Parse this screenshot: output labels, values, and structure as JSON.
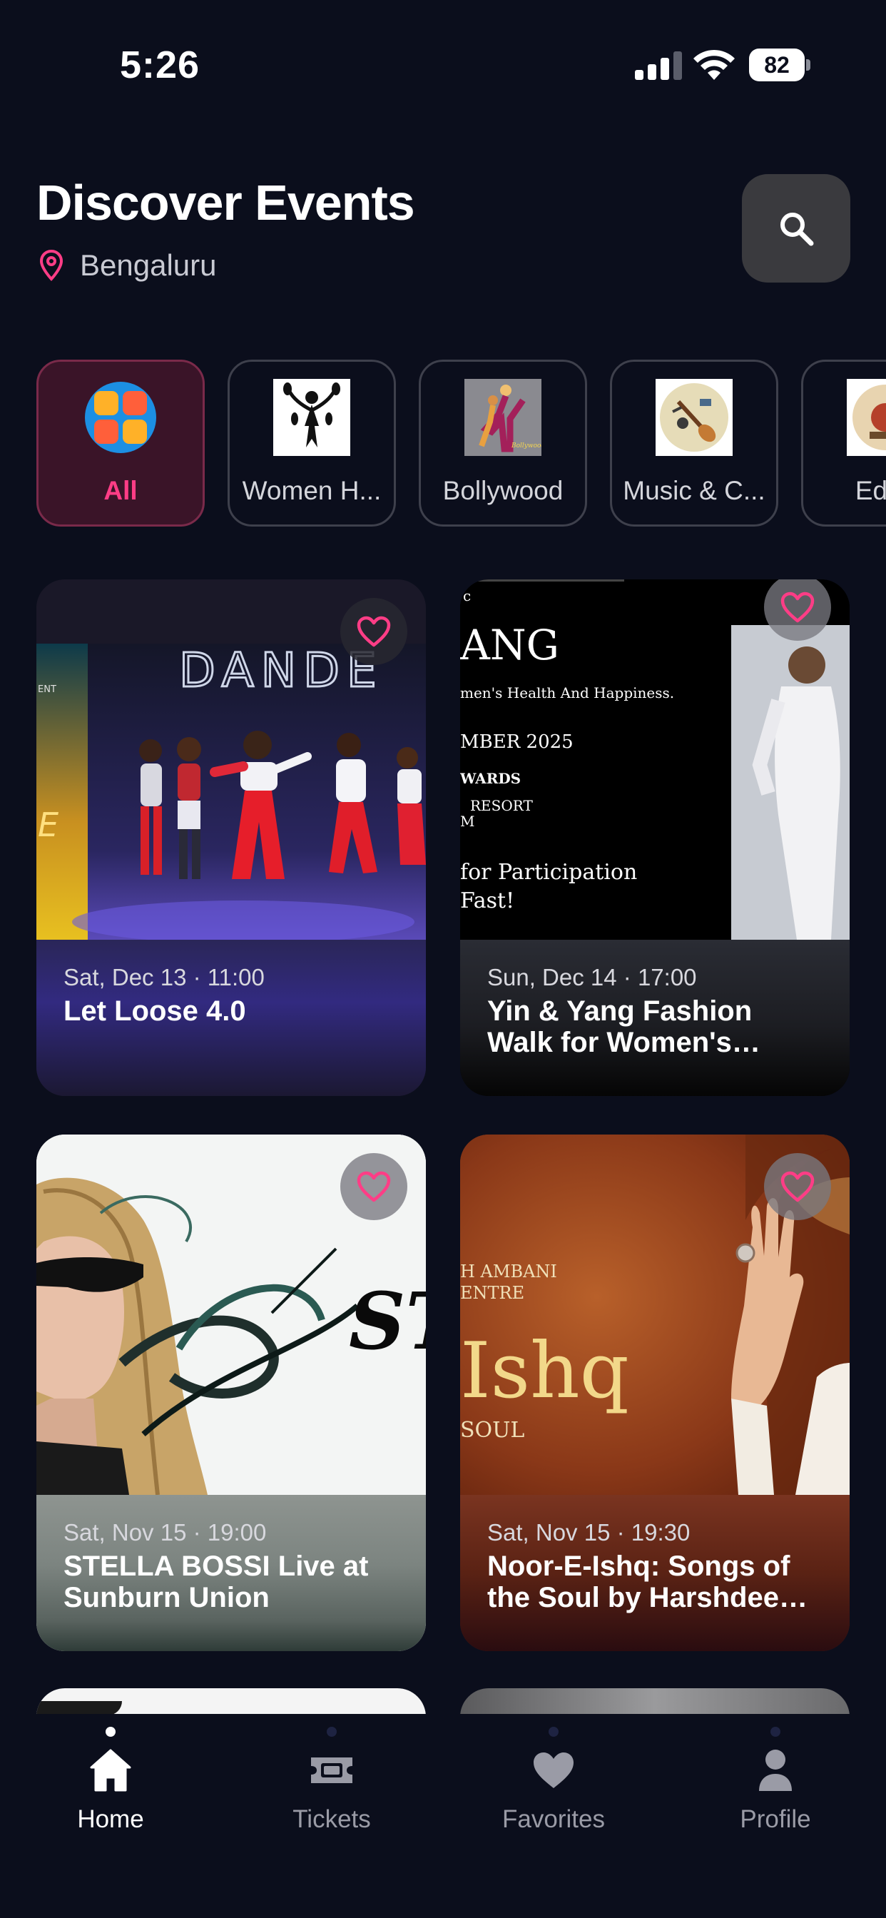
{
  "status_bar": {
    "time": "5:26",
    "battery": "82"
  },
  "header": {
    "title": "Discover Events",
    "location": "Bengaluru",
    "search_icon": "search-icon",
    "location_icon": "map-pin-icon"
  },
  "categories": [
    {
      "label": "All",
      "active": true,
      "icon": "all-grid-icon"
    },
    {
      "label": "Women H...",
      "active": false,
      "icon": "women-health-icon"
    },
    {
      "label": "Bollywood",
      "active": false,
      "icon": "bollywood-dance-icon"
    },
    {
      "label": "Music & C...",
      "active": false,
      "icon": "music-guitar-icon"
    },
    {
      "label": "Educ",
      "active": false,
      "icon": "education-icon"
    }
  ],
  "events": [
    {
      "date": "Sat, Dec 13 · 11:00",
      "title": "Let Loose 4.0"
    },
    {
      "date": "Sun, Dec 14 · 17:00",
      "title": "Yin & Yang Fashion Walk for Women's Health an..."
    },
    {
      "date": "Sat, Nov 15 · 19:00",
      "title": "STELLA BOSSI Live at Sunburn Union"
    },
    {
      "date": "Sat, Nov 15 · 19:30",
      "title": "Noor-E-Ishq: Songs of the Soul by Harshdeep ..."
    }
  ],
  "poster_text": {
    "e1_sign": "DANDE",
    "e1_side": "ENT",
    "e2_lines": [
      "ANG",
      "men's Health And Happiness.",
      "MBER 2025",
      "WARDS",
      "RESORT",
      "M",
      "for Participation",
      "Fast!"
    ],
    "e3_text": "ST BO",
    "e4_lines": [
      "H AMBANI",
      "ENTRE",
      "Ishq",
      "SOUL"
    ]
  },
  "tabs": [
    {
      "label": "Home",
      "icon": "home-icon",
      "active": true
    },
    {
      "label": "Tickets",
      "icon": "ticket-icon",
      "active": false
    },
    {
      "label": "Favorites",
      "icon": "heart-icon",
      "active": false
    },
    {
      "label": "Profile",
      "icon": "profile-icon",
      "active": false
    }
  ],
  "colors": {
    "background": "#0b0e1c",
    "accent_pink": "#ff3d86",
    "active_chip_bg": "#3a1428",
    "search_button_bg": "#3a3a3e"
  }
}
